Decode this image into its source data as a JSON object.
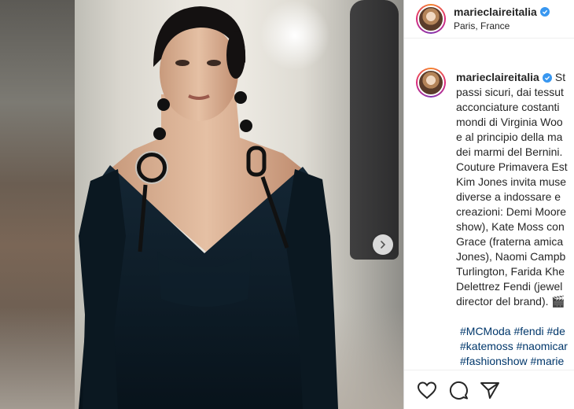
{
  "post": {
    "username": "marieclaireitalia",
    "location": "Paris, France",
    "caption_lines": [
      "St",
      "passi sicuri, dai tessut",
      "acconciature costanti",
      "mondi di Virginia Woo",
      "e al principio della ma",
      "dei marmi del Bernini.",
      "Couture Primavera Est",
      "Kim Jones invita muse",
      "diverse a indossare e",
      "creazioni: Demi Moore",
      "show), Kate Moss con",
      "Grace (fraterna amica",
      "Jones), Naomi Campb",
      "Turlington, Farida Khe",
      "Delettrez Fendi (jewel",
      "director del brand). 🎬"
    ],
    "hashtag_lines": [
      "#MCModa #fendi #de",
      "#katemoss #naomicar",
      "#fashionshow #marie"
    ]
  },
  "icons": {
    "verified": "verified-badge-icon",
    "next": "chevron-right-icon",
    "like": "heart-icon",
    "comment": "comment-icon",
    "share": "paper-plane-icon"
  },
  "colors": {
    "verified": "#3897f0",
    "hashtag": "#00376b",
    "text": "#262626",
    "dress": "#0d1a24"
  }
}
